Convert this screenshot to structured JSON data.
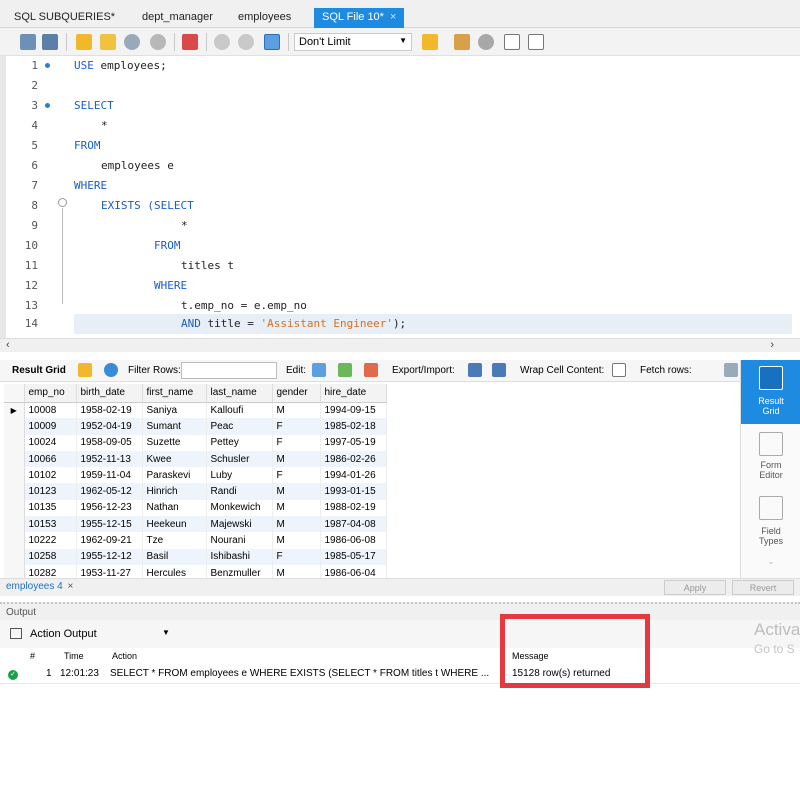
{
  "tabs": [
    {
      "label": "SQL SUBQUERIES*",
      "active": false
    },
    {
      "label": "dept_manager",
      "active": false
    },
    {
      "label": "employees",
      "active": false
    },
    {
      "label": "SQL File 10*",
      "active": true,
      "close": "×"
    }
  ],
  "toolbar": {
    "limit_value": "Don't Limit"
  },
  "editor": {
    "lines": [
      {
        "n": "1",
        "dot": true
      },
      {
        "n": "2"
      },
      {
        "n": "3",
        "dot": true
      },
      {
        "n": "4"
      },
      {
        "n": "5"
      },
      {
        "n": "6"
      },
      {
        "n": "7"
      },
      {
        "n": "8"
      },
      {
        "n": "9"
      },
      {
        "n": "10"
      },
      {
        "n": "11"
      },
      {
        "n": "12"
      },
      {
        "n": "13"
      },
      {
        "n": "14",
        "highlight": true
      }
    ],
    "code": {
      "l1_kw": "USE",
      "l1_rest": " employees;",
      "l3": "SELECT",
      "l4": "*",
      "l5": "FROM",
      "l6": "employees e",
      "l7": "WHERE",
      "l8_kw": "EXISTS (SELECT",
      "l9": "*",
      "l10": "FROM",
      "l11": "titles t",
      "l12": "WHERE",
      "l13": "t.emp_no = e.emp_no",
      "l14_kw": "AND",
      "l14_a": " title = ",
      "l14_str": "'Assistant Engineer'",
      "l14_b": ");"
    }
  },
  "result_toolbar": {
    "result_grid": "Result Grid",
    "filter_rows": "Filter Rows:",
    "edit": "Edit:",
    "export_import": "Export/Import:",
    "wrap_cell": "Wrap Cell Content:",
    "fetch_rows": "Fetch rows:"
  },
  "grid": {
    "columns": [
      "emp_no",
      "birth_date",
      "first_name",
      "last_name",
      "gender",
      "hire_date"
    ],
    "rows": [
      [
        "10008",
        "1958-02-19",
        "Saniya",
        "Kalloufi",
        "M",
        "1994-09-15"
      ],
      [
        "10009",
        "1952-04-19",
        "Sumant",
        "Peac",
        "F",
        "1985-02-18"
      ],
      [
        "10024",
        "1958-09-05",
        "Suzette",
        "Pettey",
        "F",
        "1997-05-19"
      ],
      [
        "10066",
        "1952-11-13",
        "Kwee",
        "Schusler",
        "M",
        "1986-02-26"
      ],
      [
        "10102",
        "1959-11-04",
        "Paraskevi",
        "Luby",
        "F",
        "1994-01-26"
      ],
      [
        "10123",
        "1962-05-12",
        "Hinrich",
        "Randi",
        "M",
        "1993-01-15"
      ],
      [
        "10135",
        "1956-12-23",
        "Nathan",
        "Monkewich",
        "M",
        "1988-02-19"
      ],
      [
        "10153",
        "1955-12-15",
        "Heekeun",
        "Majewski",
        "M",
        "1987-04-08"
      ],
      [
        "10222",
        "1962-09-21",
        "Tze",
        "Nourani",
        "M",
        "1986-06-08"
      ],
      [
        "10258",
        "1955-12-12",
        "Basil",
        "Ishibashi",
        "F",
        "1985-05-17"
      ],
      [
        "10282",
        "1953-11-27",
        "Hercules",
        "Benzmuller",
        "M",
        "1986-06-04"
      ]
    ]
  },
  "side_panel": {
    "result_grid": [
      "Result",
      "Grid"
    ],
    "form_editor": [
      "Form",
      "Editor"
    ],
    "field_types": [
      "Field",
      "Types"
    ]
  },
  "result_tabs": {
    "tab_label": "employees 4",
    "close": "×",
    "apply": "Apply",
    "revert": "Revert"
  },
  "output": {
    "header": "Output",
    "selector": "Action Output",
    "columns": {
      "hash": "#",
      "time": "Time",
      "action": "Action",
      "message": "Message"
    },
    "row": {
      "num": "1",
      "time": "12:01:23",
      "action": "SELECT * FROM  employees e WHERE  EXISTS (SELECT  * FROM titles t WHERE ...",
      "message": "15128 row(s) returned"
    }
  },
  "watermark": {
    "line1": "Activa",
    "line2": "Go to S"
  },
  "colors": {
    "accent": "#1e8be0",
    "keyword": "#1a5cc8",
    "string": "#d8701a",
    "highlight_box": "#e5393f"
  }
}
